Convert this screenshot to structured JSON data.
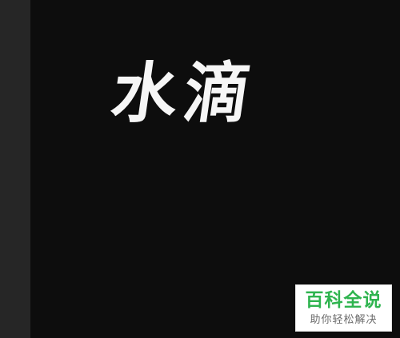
{
  "canvas": {
    "text": "水滴",
    "background_color": "#0d0d0d",
    "text_color": "#f6f6f6"
  },
  "panel": {
    "color": "#262626"
  },
  "watermark": {
    "title": "百科全说",
    "subtitle": "助你轻松解决",
    "title_color": "#2fb44f",
    "subtitle_color": "#6a6a6a"
  }
}
